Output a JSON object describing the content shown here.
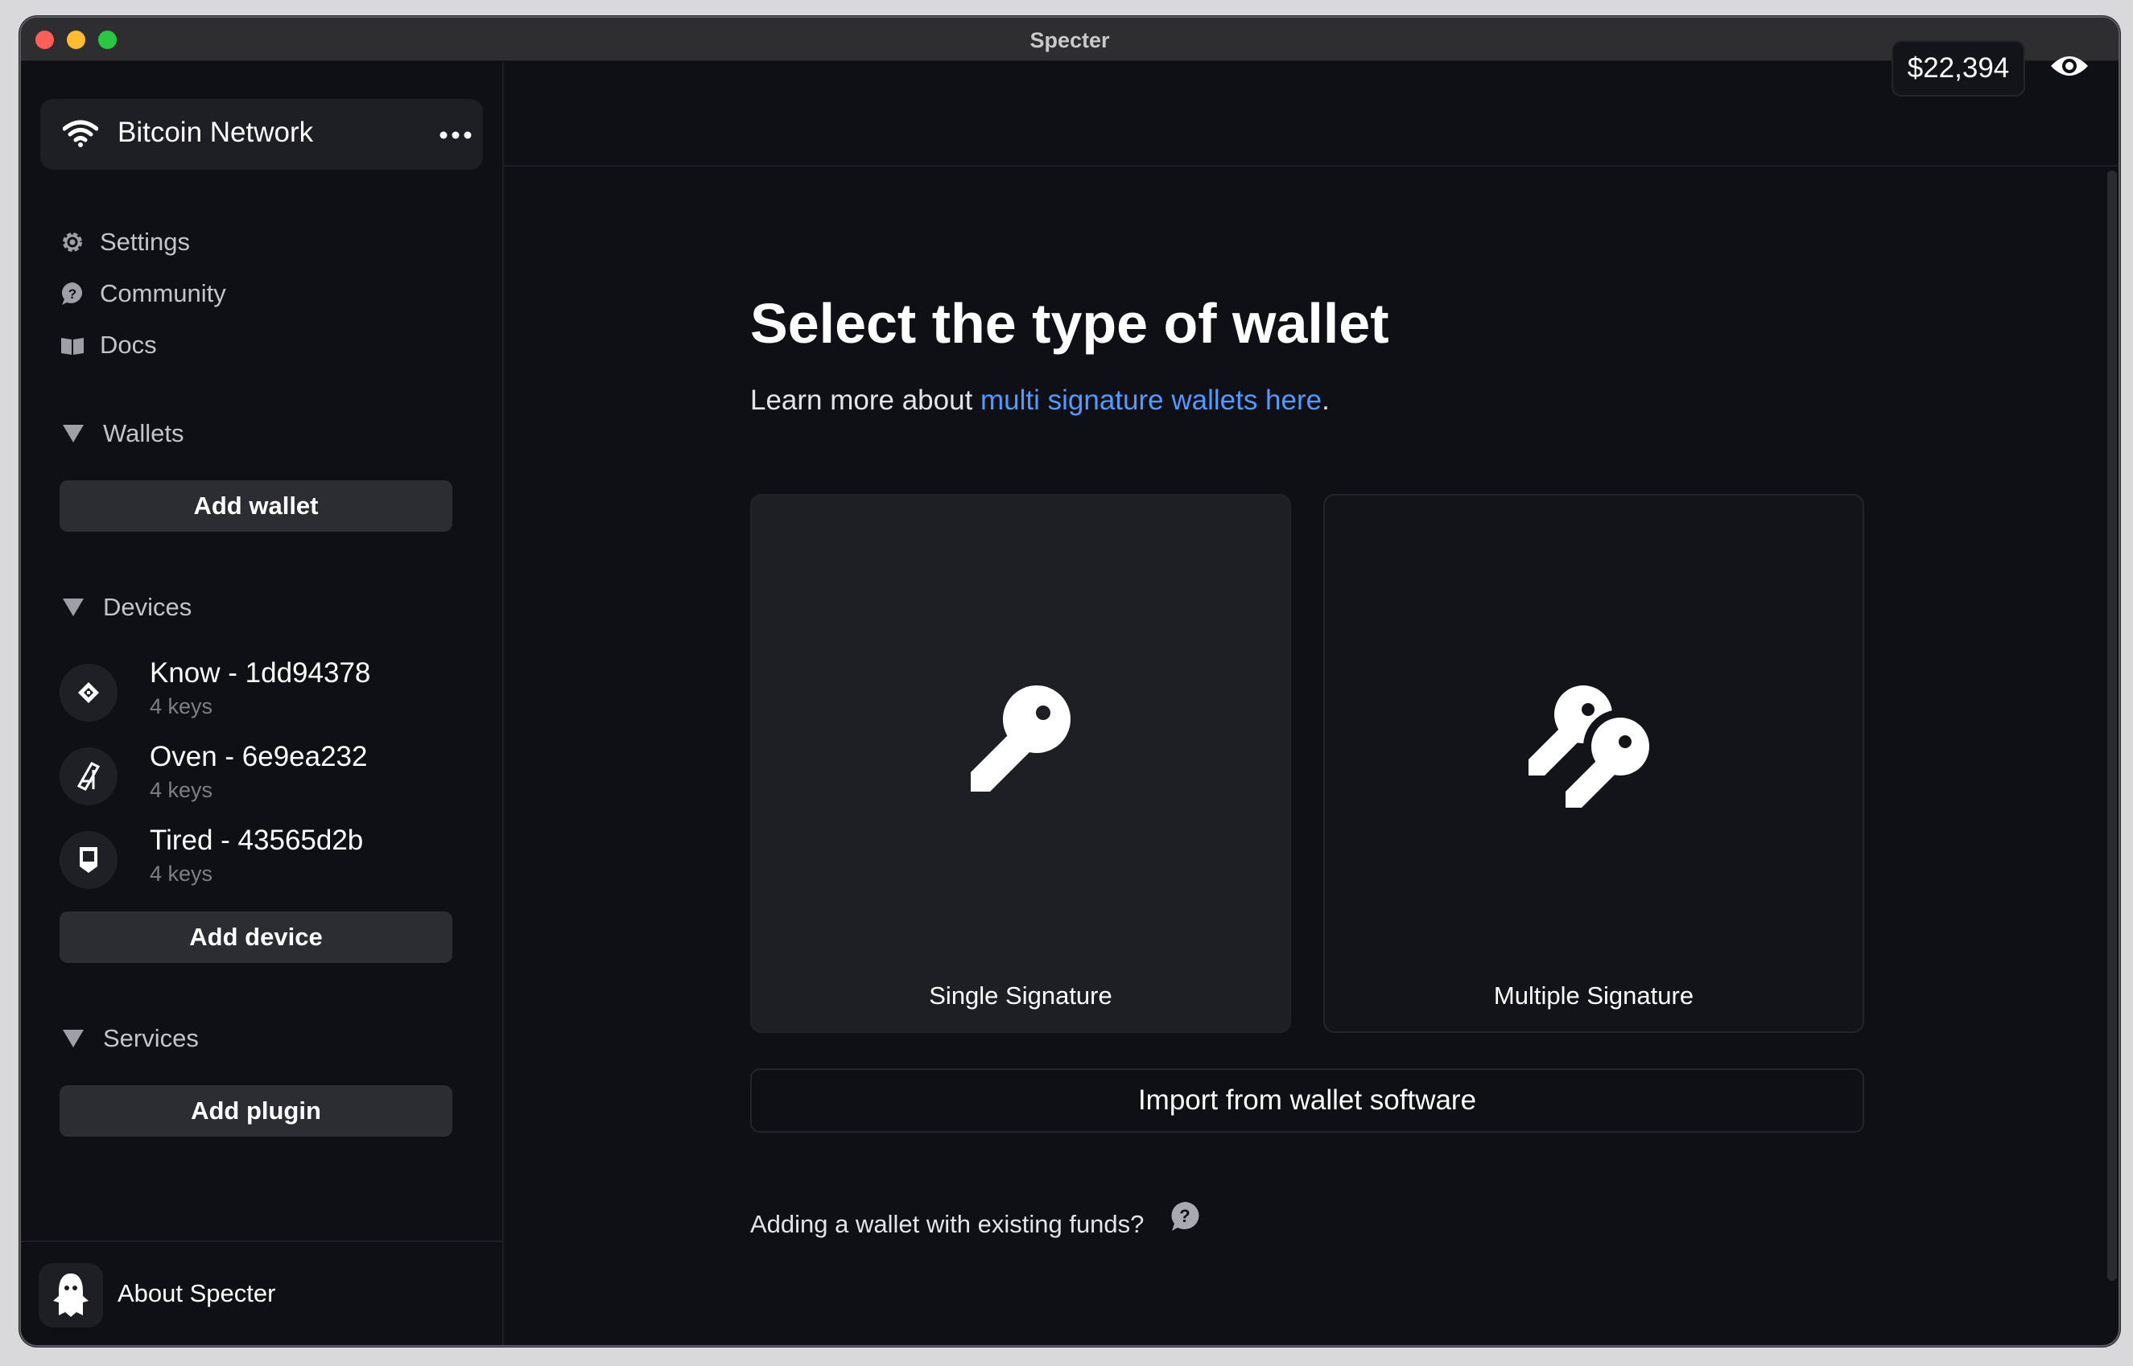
{
  "window": {
    "title": "Specter"
  },
  "sidebar": {
    "network": {
      "name": "Bitcoin Network",
      "icon": "wifi-icon",
      "menu_icon": "more-dots-icon"
    },
    "nav": [
      {
        "label": "Settings",
        "icon": "gear-icon"
      },
      {
        "label": "Community",
        "icon": "chat-question-icon"
      },
      {
        "label": "Docs",
        "icon": "book-icon"
      }
    ],
    "wallets": {
      "label": "Wallets",
      "add_label": "Add wallet"
    },
    "devices": {
      "label": "Devices",
      "items": [
        {
          "name": "Know - 1dd94378",
          "keys": "4 keys",
          "icon": "coldcard-diamond-icon"
        },
        {
          "name": "Oven - 6e9ea232",
          "keys": "4 keys",
          "icon": "jade-device-icon"
        },
        {
          "name": "Tired - 43565d2b",
          "keys": "4 keys",
          "icon": "trezor-device-icon"
        }
      ],
      "add_label": "Add device"
    },
    "services": {
      "label": "Services",
      "add_label": "Add plugin"
    },
    "about": {
      "label": "About Specter",
      "icon": "ghost-icon"
    }
  },
  "topbar": {
    "balance": "$22,394",
    "eye_icon": "eye-icon"
  },
  "main": {
    "heading": "Select the type of wallet",
    "learn_prefix": "Learn more about ",
    "learn_link": "multi signature wallets here",
    "learn_suffix": ".",
    "single_label": "Single Signature",
    "multi_label": "Multiple Signature",
    "import_label": "Import from wallet software",
    "existing_funds": "Adding a wallet with existing funds?"
  },
  "colors": {
    "link": "#4f9bff",
    "background": "#0f1016",
    "card": "#1e1f25"
  }
}
